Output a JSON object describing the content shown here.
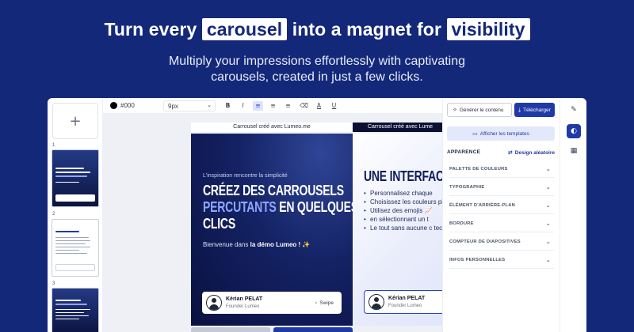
{
  "hero": {
    "title_pre": "Turn every",
    "title_hl1": "carousel",
    "title_mid": "into a magnet for",
    "title_hl2": "visibility",
    "subtitle": "Multiply your impressions effortlessly with captivating carousels, created in just a few clicks."
  },
  "sidebar": {
    "add_icon": "plus-icon",
    "add_glyph": "+",
    "thumbs": [
      {
        "number": "1"
      },
      {
        "number": "2"
      },
      {
        "number": "3"
      }
    ]
  },
  "toolbar": {
    "color_value": "#000",
    "font_size": "9px",
    "chevron": "⌄",
    "buttons": [
      {
        "name": "bold-icon",
        "glyph": "B"
      },
      {
        "name": "italic-icon",
        "glyph": "I"
      },
      {
        "name": "align-left-icon",
        "glyph": "≡"
      },
      {
        "name": "align-center-icon",
        "glyph": "≡"
      },
      {
        "name": "align-right-icon",
        "glyph": "≡"
      },
      {
        "name": "clear-format-icon",
        "glyph": "⌫"
      },
      {
        "name": "text-color-icon",
        "glyph": "A"
      },
      {
        "name": "underline-icon",
        "glyph": "U"
      }
    ]
  },
  "slides": {
    "caption1": "Carrousel créé avec Lumeo.me",
    "caption2": "Carrousel créé avec Lume",
    "slide1": {
      "tagline": "L'inspiration rencontre la simplicité",
      "title_l1": "CRÉEZ DES CARROUSELS",
      "title_acc": "PERCUTANTS",
      "title_l2_rest": " EN QUELQUES",
      "title_l3": "CLICS",
      "sub_pre": "Bienvenue dans ",
      "sub_bold": "la démo Lumeo !",
      "sub_emoji": " ✨",
      "card_name": "Kérian PELAT",
      "card_role": "Founder Lumeo",
      "card_swipe": "Swipe",
      "swipe_glyph": "›"
    },
    "slide2": {
      "title": "UNE INTERFACE",
      "bullets": [
        "Personnalisez chaque",
        "Choisissez les couleurs plan",
        "Utilisez des emojis 📈",
        "en sélectionnant un t",
        "Le tout sans aucune c technique !"
      ],
      "card_name": "Kérian PELAT",
      "card_role": "Founder Lumeo"
    }
  },
  "panel": {
    "generate_label": "Générer le contenu",
    "download_label": "Télécharger",
    "templates_label": "Afficher les templates",
    "appearance_label": "APPARENCE",
    "random_label": "Design aléatoire",
    "sections": [
      "PALETTE DE COULEURS",
      "TYPOGRAPHIE",
      "ÉLÉMENT D'ARRIÈRE-PLAN",
      "BORDURE",
      "COMPTEUR DE DIAPOSITIVES",
      "INFOS PERSONNELLES"
    ],
    "chevron": "⌄"
  },
  "rail": {
    "edit_glyph": "✎",
    "palette_glyph": "◐",
    "layout_glyph": "▦"
  },
  "colors": {
    "background": "#14287a",
    "accent": "#1f3aa6",
    "slide_accent": "#8fa7ff"
  }
}
